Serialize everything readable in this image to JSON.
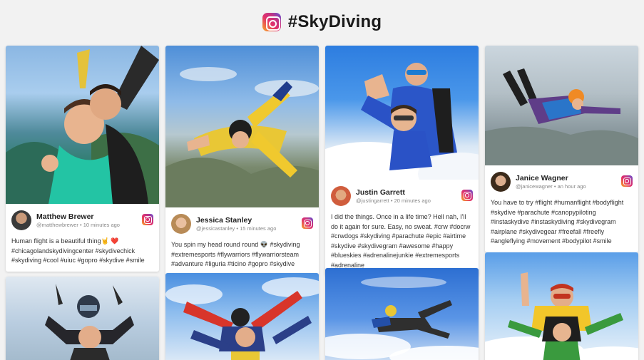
{
  "header": {
    "title": "#SkyDiving",
    "icon": "instagram-icon"
  },
  "posts": [
    {
      "name": "Matthew Brewer",
      "handle": "@matthewbrewer",
      "time": "10 minutes ago",
      "text": "Human flight is a beautiful thing🤘 ❤️#chicagolandskydivingcenter #skydivechick #skydiving #cool #uiuc #gopro #skydive #smile"
    },
    {
      "name": "Jessica Stanley",
      "handle": "@jessicastanley",
      "time": "15 minutes ago",
      "text": "You spin my head round round 👽 #skydiving #extremesports #flywarriors #flywarriorsteam #advanture #liguria #ticino #gopro #skydive"
    },
    {
      "name": "Justin Garrett",
      "handle": "@justingarrett",
      "time": "20 minutes ago",
      "text": "I did the things. Once in a life time? Hell nah, I'll do it again for sure. Easy, no sweat. #crw #docrw #crwdogs #skydiving #parachute #epic #airtime #skydive #skydivegram #awesome #happy #blueskies #adrenalinejunkie #extremesports #adrenaline"
    },
    {
      "name": "Janice Wagner",
      "handle": "@janicewagner",
      "time": "an hour ago",
      "text": "You have to try #flight #humanflight #bodyflight #skydive #parachute #canopypiloting #instaskydive #instaskydiving #skydivegram #airplane #skydivegear #freefall #freefly #angleflying #movement #bodypilot #smile"
    }
  ],
  "colors": {
    "background": "#f2f2f2",
    "card": "#ffffff",
    "instagram_gradient": [
      "#f9a825",
      "#e1306c",
      "#c13584",
      "#5851db"
    ]
  }
}
